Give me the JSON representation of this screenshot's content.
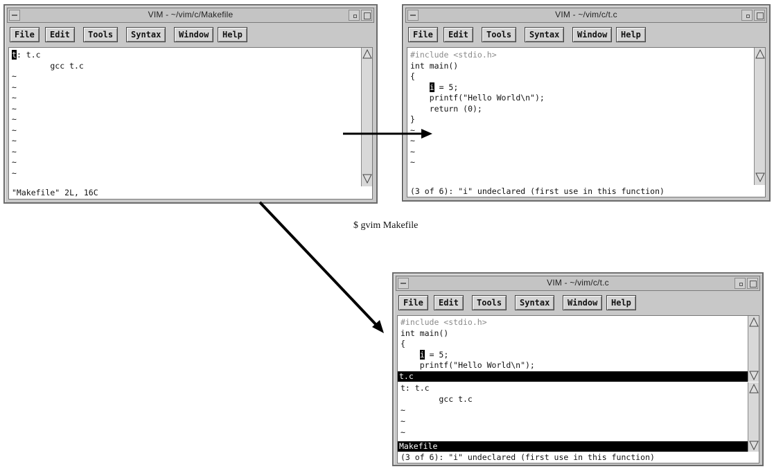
{
  "caption": "$ gvim Makefile",
  "menu": [
    "File",
    "Edit",
    "Tools",
    "Syntax",
    "Window",
    "Help"
  ],
  "window_left": {
    "title": "VIM - ~/vim/c/Makefile",
    "lines": [
      "t: t.c",
      "        gcc t.c",
      "~",
      "~",
      "~",
      "~",
      "~",
      "~",
      "~",
      "~",
      "~",
      "~"
    ],
    "message": "\"Makefile\" 2L, 16C"
  },
  "window_right": {
    "title": "VIM - ~/vim/c/t.c",
    "lines": [
      "#include <stdio.h>",
      "int main()",
      "{",
      "    i = 5;",
      "    printf(\"Hello World\\n\");",
      "    return (0);",
      "}",
      "~",
      "~",
      "~",
      "~"
    ],
    "message": "(3 of 6): \"i\" undeclared (first use in this function)"
  },
  "window_bottom": {
    "title": "VIM - ~/vim/c/t.c",
    "top_lines": [
      "#include <stdio.h>",
      "int main()",
      "{",
      "    i = 5;",
      "    printf(\"Hello World\\n\");"
    ],
    "top_status": "t.c",
    "bottom_lines": [
      "t: t.c",
      "        gcc t.c",
      "~",
      "~",
      "~"
    ],
    "bottom_status": "Makefile",
    "message": "(3 of 6): \"i\" undeclared (first use in this function)"
  },
  "colors": {
    "window_bg": "#c8c8c8",
    "text_bg": "#ffffff",
    "status_bg": "#000000",
    "dim_text": "#8a8a8a"
  },
  "icons": [
    "system-menu-icon",
    "minimize-icon",
    "maximize-icon",
    "scroll-up-icon",
    "scroll-down-icon",
    "arrow-icon"
  ]
}
